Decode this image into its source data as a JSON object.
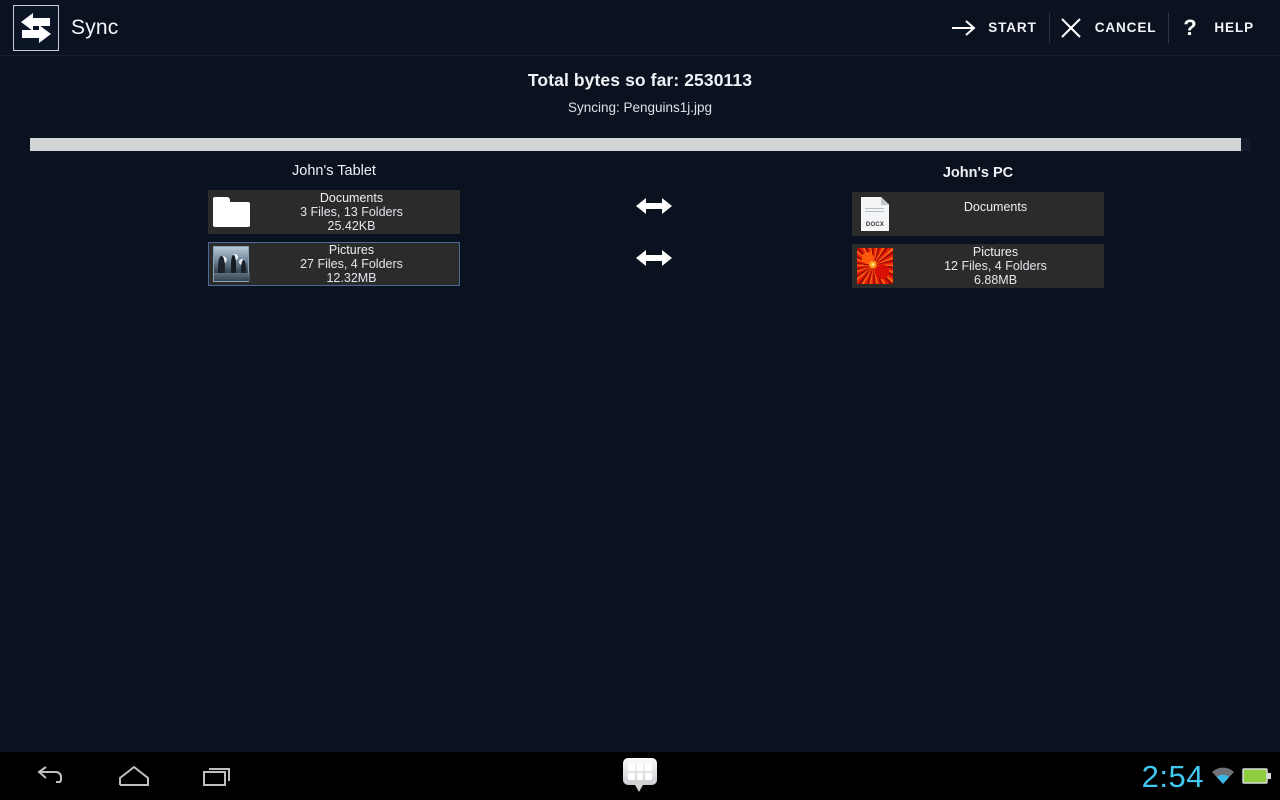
{
  "app": {
    "title": "Sync",
    "icon": "sync-arrows-icon"
  },
  "action_bar": {
    "actions": [
      {
        "id": "start",
        "label": "START",
        "icon": "arrow-right-icon"
      },
      {
        "id": "cancel",
        "label": "CANCEL",
        "icon": "close-x-icon"
      },
      {
        "id": "help",
        "label": "HELP",
        "icon": "question-mark-icon"
      }
    ]
  },
  "status": {
    "total_bytes_line": "Total bytes so far: 2530113",
    "syncing_line": "Syncing: Penguins1j.jpg"
  },
  "progress": {
    "percent": 99.3
  },
  "panels": {
    "left": {
      "title": "John's Tablet",
      "items": [
        {
          "name": "Documents",
          "meta": "3 Files, 13 Folders",
          "size": "25.42KB",
          "icon": "folder-icon",
          "selected": false
        },
        {
          "name": "Pictures",
          "meta": "27 Files, 4 Folders",
          "size": "12.32MB",
          "icon": "penguins-thumbnail",
          "selected": true
        }
      ]
    },
    "right": {
      "title": "John's PC",
      "items": [
        {
          "name": "Documents",
          "meta": "",
          "size": "",
          "icon": "docx-file-icon",
          "selected": false
        },
        {
          "name": "Pictures",
          "meta": "12 Files, 4 Folders",
          "size": "6.88MB",
          "icon": "red-flower-thumbnail",
          "selected": false
        }
      ]
    }
  },
  "sync_links": [
    {
      "icon": "double-arrow-icon"
    },
    {
      "icon": "double-arrow-icon"
    }
  ],
  "system_nav": {
    "back": "back-icon",
    "home": "home-icon",
    "recents": "recent-apps-icon",
    "ime": "keyboard-switcher-icon",
    "clock": "2:54",
    "wifi": "wifi-icon",
    "battery": "battery-icon"
  },
  "colors": {
    "background": "#0a1220",
    "row_background": "#2b2b2b",
    "row_selected_border": "#4a6b96",
    "progress_fill": "#d2d4d6",
    "clock": "#3fc8f0",
    "battery": "#8ecd3f"
  }
}
